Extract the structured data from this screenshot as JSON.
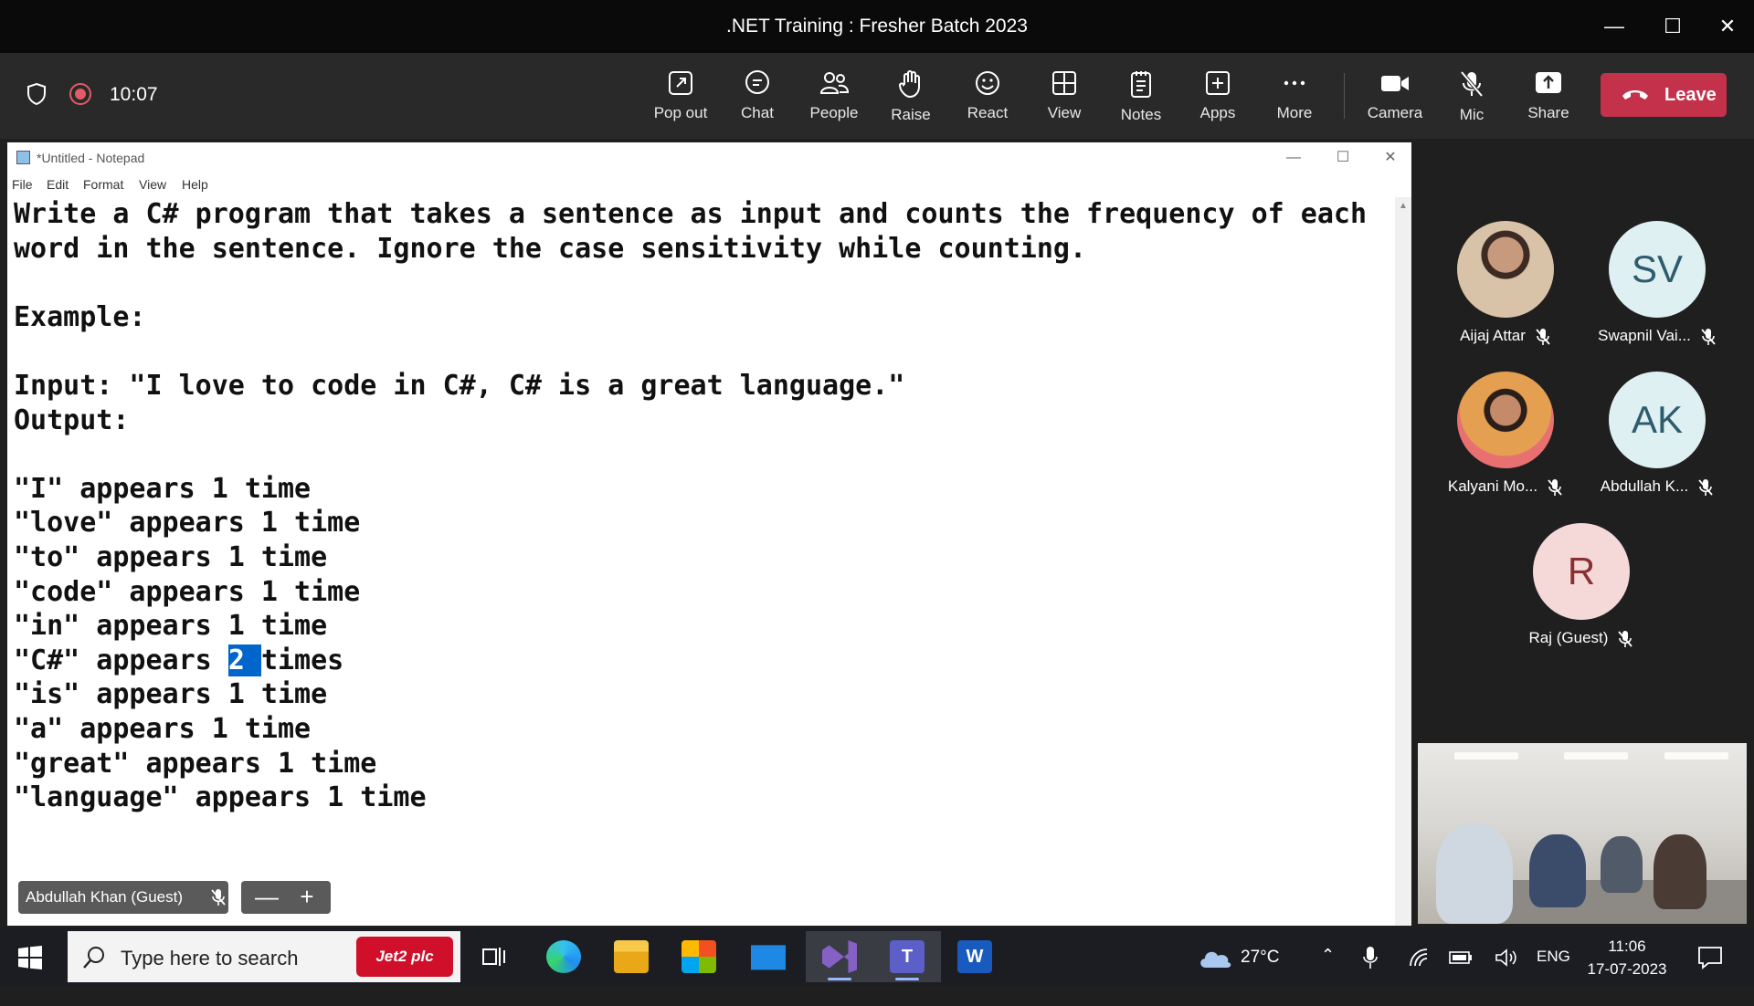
{
  "window": {
    "title": ".NET Training : Fresher Batch 2023"
  },
  "meeting": {
    "timer": "10:07",
    "tools": [
      {
        "label": "Pop out",
        "icon": "pop-out-icon"
      },
      {
        "label": "Chat",
        "icon": "chat-icon"
      },
      {
        "label": "People",
        "icon": "people-icon"
      },
      {
        "label": "Raise",
        "icon": "raise-hand-icon"
      },
      {
        "label": "React",
        "icon": "react-icon"
      },
      {
        "label": "View",
        "icon": "view-icon"
      },
      {
        "label": "Notes",
        "icon": "notes-icon"
      },
      {
        "label": "Apps",
        "icon": "apps-icon"
      },
      {
        "label": "More",
        "icon": "more-icon"
      },
      {
        "label": "Camera",
        "icon": "camera-icon"
      },
      {
        "label": "Mic",
        "icon": "mic-off-icon"
      },
      {
        "label": "Share",
        "icon": "share-icon"
      }
    ],
    "leave_label": "Leave",
    "leave_color": "#c4314b"
  },
  "notepad": {
    "title": "*Untitled - Notepad",
    "menu": [
      "File",
      "Edit",
      "Format",
      "View",
      "Help"
    ],
    "lines": [
      "Write a C# program that takes a sentence as input and counts the frequency of each",
      "word in the sentence. Ignore the case sensitivity while counting.",
      "",
      "Example:",
      "",
      "Input: \"I love to code in C#, C# is a great language.\"",
      "Output:",
      "",
      "\"I\" appears 1 time",
      "\"love\" appears 1 time",
      "\"to\" appears 1 time",
      "\"code\" appears 1 time",
      "\"in\" appears 1 time",
      "\"C#\" appears ",
      "\"is\" appears 1 time",
      "\"a\" appears 1 time",
      "\"great\" appears 1 time",
      "\"language\" appears 1 time"
    ],
    "selected_text": "2 ",
    "after_selection": "times"
  },
  "participants": [
    {
      "name": "Aijaj Attar",
      "avatar": "photo",
      "muted": true
    },
    {
      "name": "Swapnil Vai...",
      "initials": "SV",
      "muted": true
    },
    {
      "name": "Kalyani Mo...",
      "avatar": "photo",
      "muted": true
    },
    {
      "name": "Abdullah K...",
      "initials": "AK",
      "muted": true
    },
    {
      "name": "Raj (Guest)",
      "initials": "R",
      "muted": true
    }
  ],
  "stage": {
    "name_plate": "Abdullah Khan (Guest)",
    "zoom_out": "—",
    "zoom_in": "+"
  },
  "taskbar": {
    "search_placeholder": "Type here to search",
    "search_ad": "Jet2 plc",
    "weather": "27°C",
    "language": "ENG",
    "time": "11:06",
    "date": "17-07-2023"
  }
}
